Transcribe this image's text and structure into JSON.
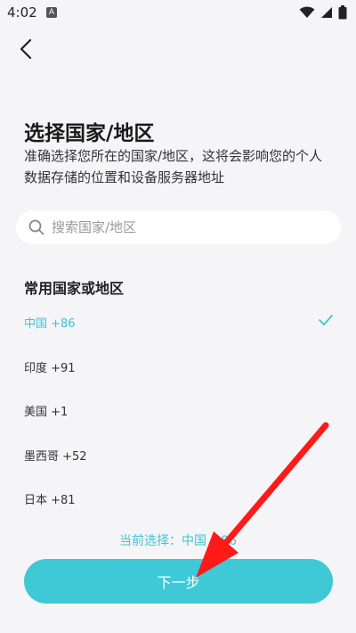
{
  "status_bar": {
    "time": "4:02",
    "notification_glyph": "A"
  },
  "header": {
    "title": "选择国家/地区",
    "description": "准确选择您所在的国家/地区，这将会影响您的个人数据存储的位置和设备服务器地址"
  },
  "search": {
    "placeholder": "搜索国家/地区",
    "value": ""
  },
  "section": {
    "title": "常用国家或地区"
  },
  "regions": [
    {
      "label": "中国 +86",
      "selected": true
    },
    {
      "label": "印度 +91",
      "selected": false
    },
    {
      "label": "美国 +1",
      "selected": false
    },
    {
      "label": "墨西哥 +52",
      "selected": false
    },
    {
      "label": "日本 +81",
      "selected": false
    }
  ],
  "current_selection": {
    "text": "当前选择：中国 +86"
  },
  "next_button": {
    "label": "下一步"
  },
  "colors": {
    "accent": "#3ec3d5",
    "button": "#3fc8d6",
    "background": "#f5f5f7",
    "annotation": "#ff1a1a"
  },
  "icons": {
    "back": "chevron-left-icon",
    "search": "search-icon",
    "check": "check-icon",
    "wifi": "wifi-icon",
    "signal": "signal-icon",
    "battery": "battery-icon"
  }
}
